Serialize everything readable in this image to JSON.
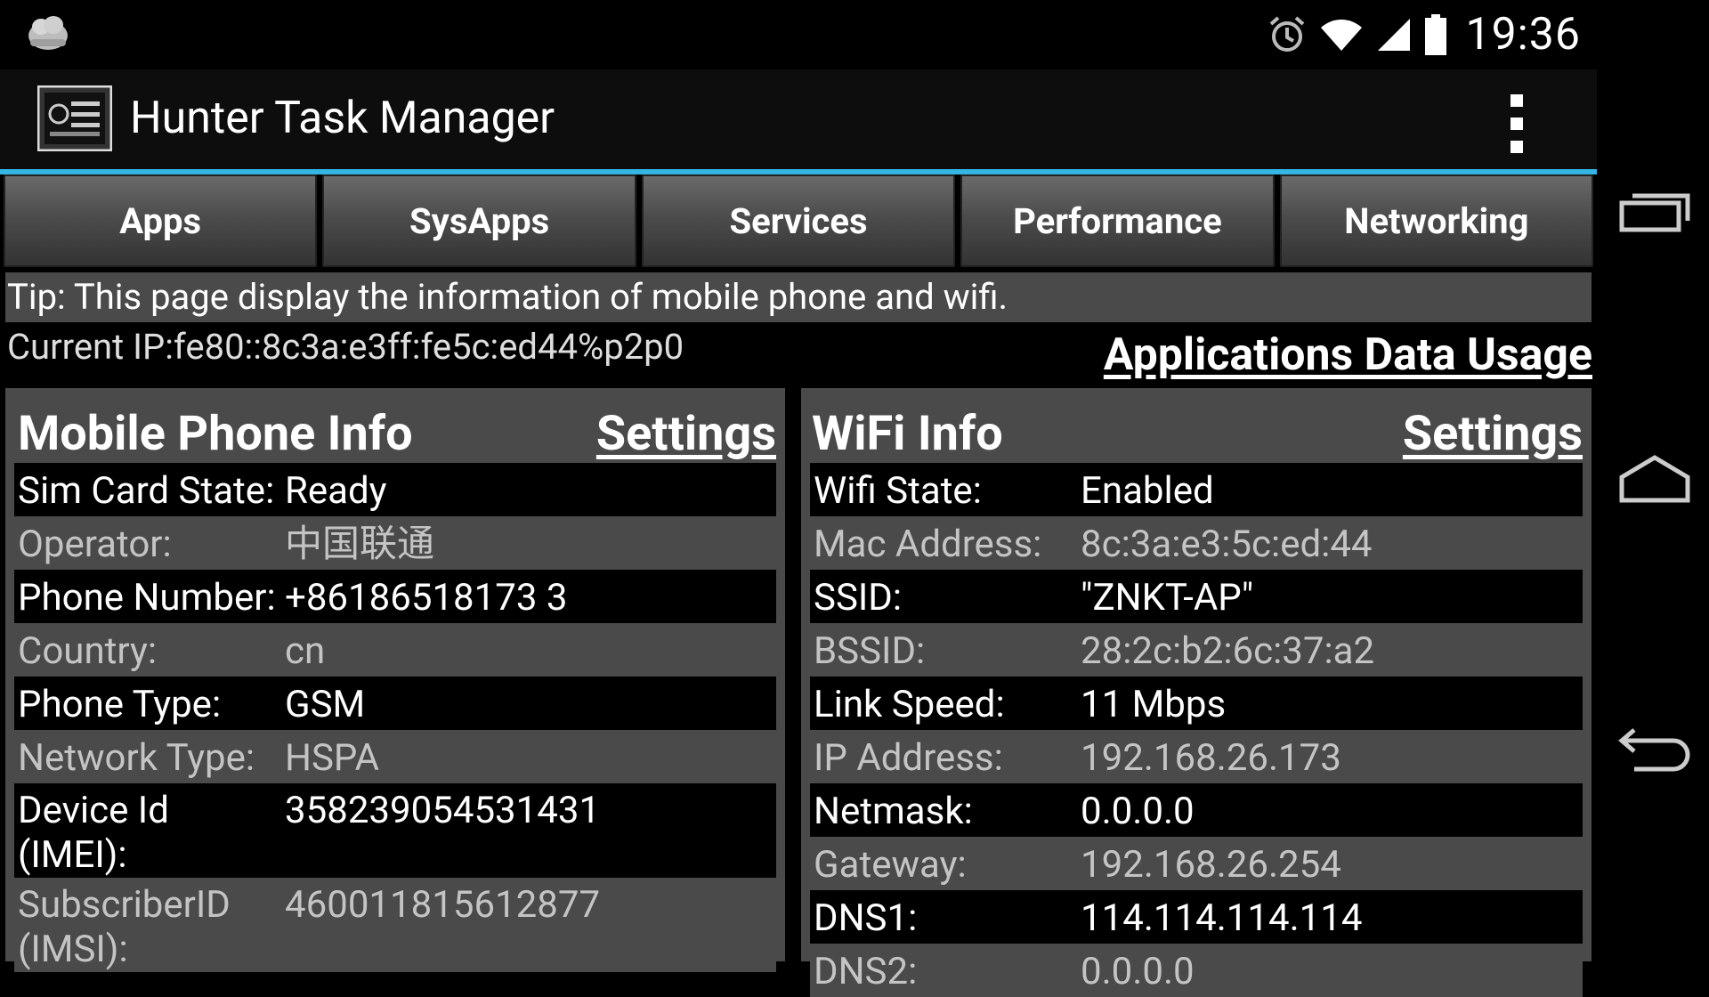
{
  "status_bar": {
    "time": "19:36",
    "icons": [
      "notification-icon",
      "alarm-icon",
      "wifi-icon",
      "signal-icon",
      "battery-icon"
    ]
  },
  "action_bar": {
    "title": "Hunter Task Manager",
    "icon": "task-manager-icon",
    "overflow_icon": "overflow-menu-icon"
  },
  "tabs": [
    "Apps",
    "SysApps",
    "Services",
    "Performance",
    "Networking"
  ],
  "tip": "Tip: This page display the information of mobile phone and wifi.",
  "current_ip": "Current IP:fe80::8c3a:e3ff:fe5c:ed44%p2p0",
  "data_usage_link": "Applications Data Usage",
  "mobile_panel": {
    "title": "Mobile Phone Info",
    "settings": "Settings",
    "rows": [
      {
        "label": "Sim Card State:",
        "value": "Ready"
      },
      {
        "label": "Operator:",
        "value": "中国联通"
      },
      {
        "label": "Phone Number:",
        "value": "+86186518173 3"
      },
      {
        "label": "Country:",
        "value": "cn"
      },
      {
        "label": "Phone Type:",
        "value": "GSM"
      },
      {
        "label": "Network Type:",
        "value": "HSPA"
      },
      {
        "label": "Device Id (IMEI):",
        "value": "358239054531431"
      },
      {
        "label": "SubscriberID (IMSI):",
        "value": "460011815612877"
      }
    ]
  },
  "wifi_panel": {
    "title": "WiFi Info",
    "settings": "Settings",
    "rows": [
      {
        "label": "Wifi State:",
        "value": "Enabled"
      },
      {
        "label": "Mac Address:",
        "value": "8c:3a:e3:5c:ed:44"
      },
      {
        "label": "SSID:",
        "value": "\"ZNKT-AP\""
      },
      {
        "label": "BSSID:",
        "value": "28:2c:b2:6c:37:a2"
      },
      {
        "label": "Link Speed:",
        "value": "11 Mbps"
      },
      {
        "label": "IP Address:",
        "value": "192.168.26.173"
      },
      {
        "label": "Netmask:",
        "value": "0.0.0.0"
      },
      {
        "label": "Gateway:",
        "value": "192.168.26.254"
      },
      {
        "label": "DNS1:",
        "value": "114.114.114.114"
      },
      {
        "label": "DNS2:",
        "value": "0.0.0.0"
      }
    ]
  },
  "nav_bar": {
    "buttons": [
      "recent-apps-icon",
      "home-icon",
      "back-icon"
    ]
  },
  "colors": {
    "accent": "#33b5e5",
    "row_dark": "#000000",
    "row_light": "#4a4a4a"
  }
}
